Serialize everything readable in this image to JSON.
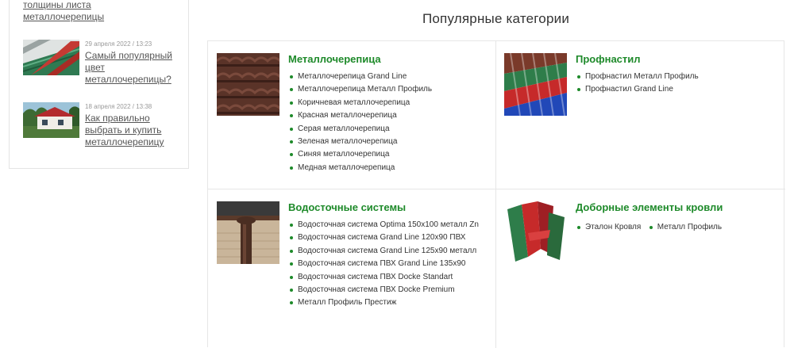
{
  "sidebar": {
    "top_link": "толщины листа металлочерепицы",
    "articles": [
      {
        "date": "29 апреля 2022 / 13:23",
        "title": "Самый популярный цвет металлочерепицы?"
      },
      {
        "date": "18 апреля 2022 / 13:38",
        "title": "Как правильно выбрать и купить металлочерепицу"
      }
    ]
  },
  "main": {
    "heading": "Популярные категории",
    "categories": [
      {
        "title": "Металлочерепица",
        "items": [
          "Металлочерепица Grand Line",
          "Металлочерепица Металл Профиль",
          "Коричневая металлочерепица",
          "Красная металлочерепица",
          "Серая металлочерепица",
          "Зеленая металлочерепица",
          "Синяя металлочерепица",
          "Медная металлочерепица"
        ]
      },
      {
        "title": "Профнастил",
        "items": [
          "Профнастил Металл Профиль",
          "Профнастил Grand Line"
        ]
      },
      {
        "title": "Водосточные системы",
        "items": [
          "Водосточная система Optima 150x100 металл Zn",
          "Водосточная система Grand Line 120x90 ПВХ",
          "Водосточная система Grand Line 125x90 металл",
          "Водосточная система ПВХ Grand Line 135x90",
          "Водосточная система ПВХ Docke Standart",
          "Водосточная система ПВХ Docke Premium",
          "Металл Профиль Престиж"
        ]
      },
      {
        "title": "Доборные элементы кровли",
        "items": [
          "Эталон Кровля",
          "Металл Профиль"
        ]
      }
    ]
  },
  "colors": {
    "accent": "#1e8a2a",
    "border": "#e6e6e6"
  }
}
